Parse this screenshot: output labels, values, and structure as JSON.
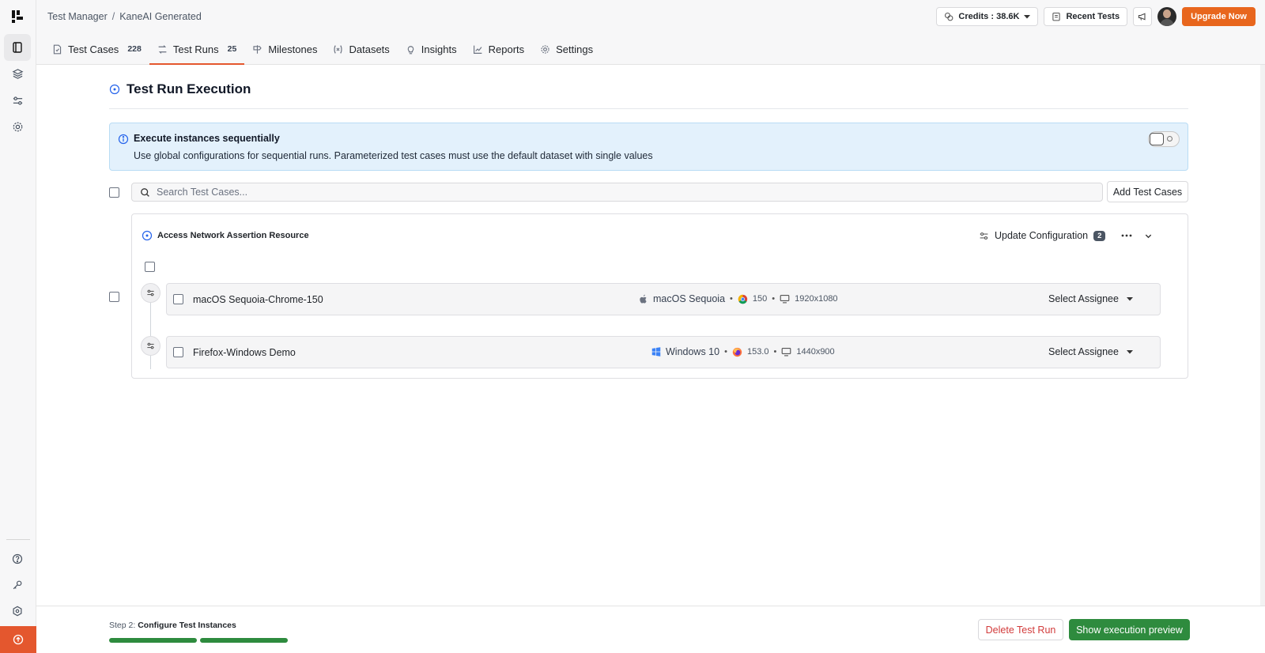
{
  "breadcrumb": {
    "root": "Test Manager",
    "separator": "/",
    "current": "KaneAI Generated"
  },
  "header": {
    "credits_label": "Credits : 38.6K",
    "recent_tests_label": "Recent Tests",
    "upgrade_label": "Upgrade Now"
  },
  "tabs": [
    {
      "label": "Test Cases",
      "count": "228"
    },
    {
      "label": "Test Runs",
      "count": "25"
    },
    {
      "label": "Milestones"
    },
    {
      "label": "Datasets"
    },
    {
      "label": "Insights"
    },
    {
      "label": "Reports"
    },
    {
      "label": "Settings"
    }
  ],
  "page": {
    "title": "Test Run Execution"
  },
  "info": {
    "title": "Execute instances sequentially",
    "description": "Use global configurations for sequential runs. Parameterized test cases must use the default dataset with single values",
    "toggle_on": false
  },
  "search": {
    "placeholder": "Search Test Cases..."
  },
  "add_test_cases_label": "Add Test Cases",
  "test_case": {
    "title": "Access Network Assertion Resource",
    "update_config_label": "Update Configuration",
    "config_count": "2",
    "instances": [
      {
        "name": "macOS Sequoia-Chrome-150",
        "os": "macOS Sequoia",
        "browser_version": "150",
        "resolution": "1920x1080",
        "assignee_label": "Select Assignee"
      },
      {
        "name": "Firefox-Windows Demo",
        "os": "Windows 10",
        "browser_version": "153.0",
        "resolution": "1440x900",
        "assignee_label": "Select Assignee"
      }
    ]
  },
  "footer": {
    "step_prefix": "Step 2:",
    "step_name": "Configure Test Instances",
    "delete_label": "Delete Test Run",
    "preview_label": "Show execution preview"
  },
  "colors": {
    "accent": "#e4572e",
    "upgrade": "#e8661d",
    "success": "#2e8b3e",
    "info_bg": "#e3f1fc",
    "danger": "#d23b3b"
  }
}
